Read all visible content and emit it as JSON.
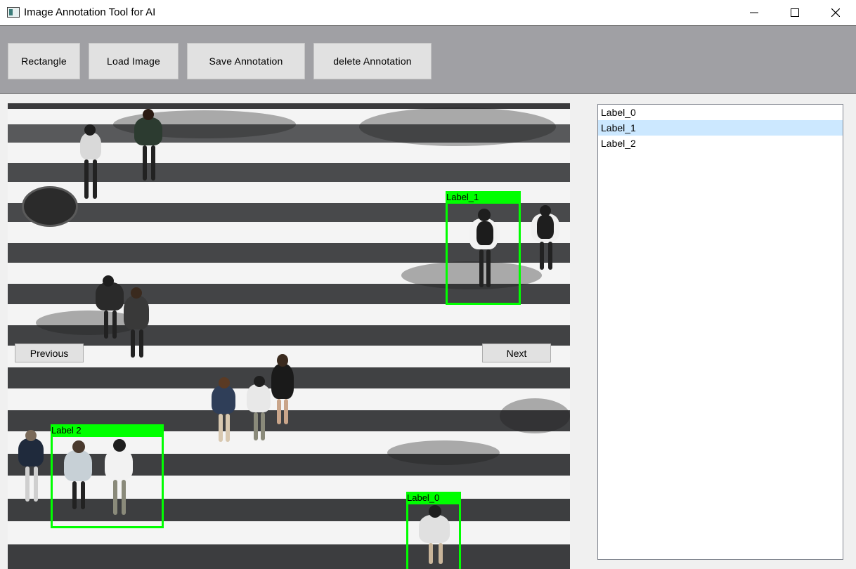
{
  "window": {
    "title": "Image Annotation Tool for AI",
    "icon": "app-icon",
    "controls": [
      "minimize-icon",
      "maximize-icon",
      "close-icon"
    ]
  },
  "toolbar": {
    "rectangle_label": "Rectangle",
    "load_label": "Load Image",
    "save_label": "Save Annotation",
    "delete_label": "delete Annotation"
  },
  "navigation": {
    "previous_label": "Previous",
    "next_label": "Next"
  },
  "annotations": [
    {
      "label": "Label_1"
    },
    {
      "label": "Label 2"
    },
    {
      "label": "Label_0"
    }
  ],
  "label_list": {
    "items": [
      "Label_0",
      "Label_1",
      "Label_2"
    ],
    "selected": "Label_1"
  },
  "colors": {
    "bbox": "#00ff00",
    "selection": "#cce8ff",
    "toolbar_bg": "#a0a0a4"
  }
}
